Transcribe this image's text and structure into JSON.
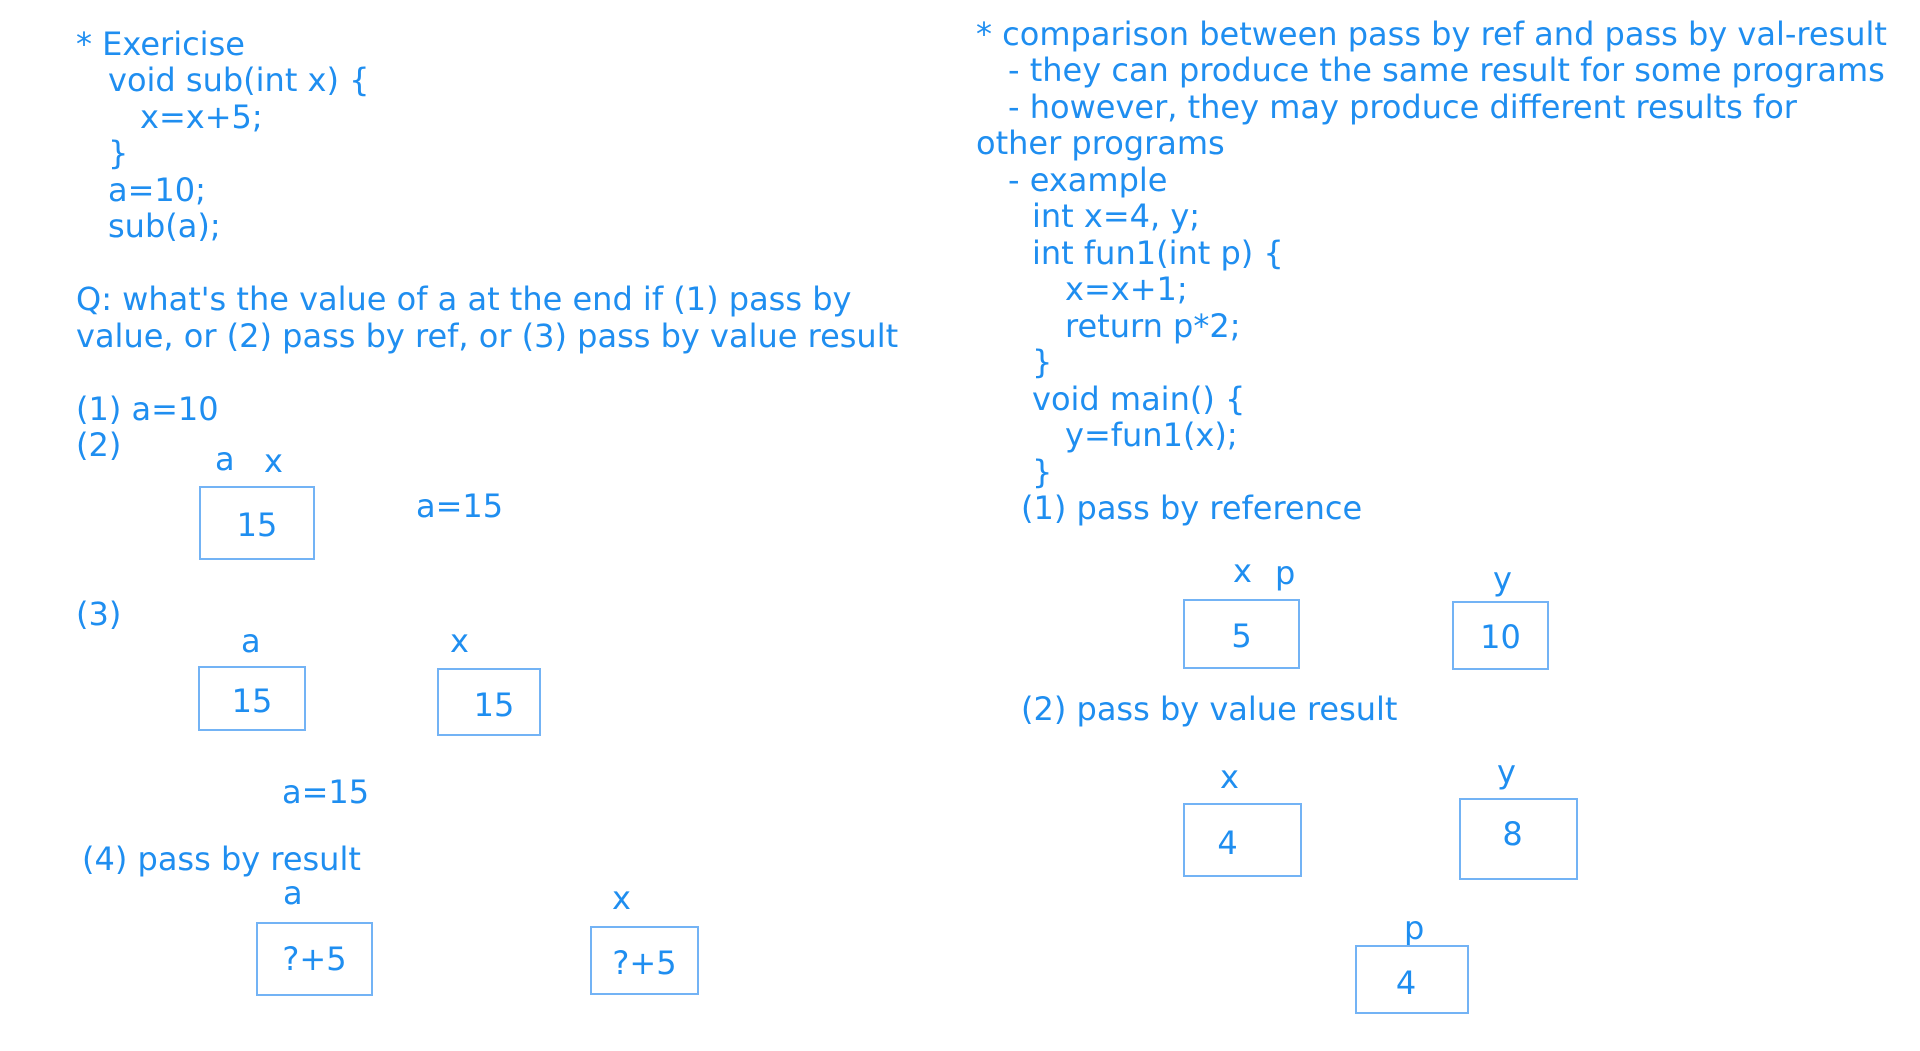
{
  "left": {
    "heading": "* Exericise",
    "code": [
      "void sub(int x) {",
      "x=x+5;",
      "}",
      "a=10;",
      "sub(a);"
    ],
    "question": [
      "Q: what's the value of a at the end if (1) pass by",
      "value, or (2) pass by ref, or (3) pass by value result"
    ],
    "case1": "(1) a=10",
    "case2": {
      "label": "(2)",
      "cell_label_a": "a",
      "cell_label_x": "x",
      "cell_value": "15",
      "result": "a=15"
    },
    "case3": {
      "label": "(3)",
      "a_label": "a",
      "a_value": "15",
      "x_label": "x",
      "x_value": "15",
      "result": "a=15"
    },
    "case4": {
      "label": "(4) pass by result",
      "a_label": "a",
      "a_value": "?+5",
      "x_label": "x",
      "x_value": "?+5"
    }
  },
  "right": {
    "heading": "* comparison between pass by ref and pass by val-result",
    "bullets": [
      "- they can produce the same result for some programs",
      "- however, they may produce different results for",
      "other programs",
      "- example"
    ],
    "code": [
      "int x=4, y;",
      "int fun1(int p) {",
      "x=x+1;",
      "return p*2;",
      "}",
      "void main() {",
      "y=fun1(x);",
      "}"
    ],
    "ref": {
      "label": "(1) pass by reference",
      "xp_label_x": "x",
      "xp_label_p": "p",
      "xp_value": "5",
      "y_label": "y",
      "y_value": "10"
    },
    "valres": {
      "label": "(2) pass by value result",
      "x_label": "x",
      "x_value": "4",
      "y_label": "y",
      "y_value": "8",
      "p_label": "p",
      "p_value": "4"
    }
  }
}
